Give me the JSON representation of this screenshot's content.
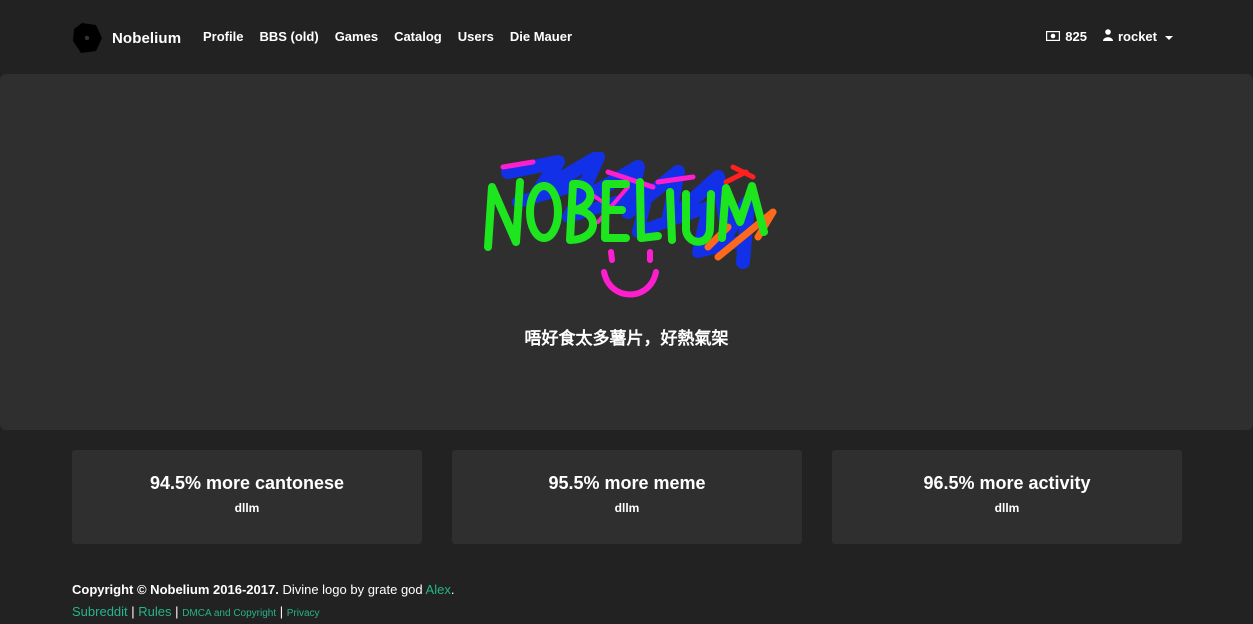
{
  "navbar": {
    "brand": "Nobelium",
    "links": [
      "Profile",
      "BBS (old)",
      "Games",
      "Catalog",
      "Users",
      "Die Mauer"
    ],
    "money": "825",
    "username": "rocket"
  },
  "hero": {
    "logo_text": "NOBELIUM",
    "tagline": "唔好食太多薯片，好熱氣架"
  },
  "features": [
    {
      "title": "94.5% more cantonese",
      "subtitle": "dllm"
    },
    {
      "title": "95.5% more meme",
      "subtitle": "dllm"
    },
    {
      "title": "96.5% more activity",
      "subtitle": "dllm"
    }
  ],
  "footer": {
    "copyright": "Copyright © Nobelium 2016-2017.",
    "logo_credit": "Divine logo by grate god",
    "credit_link": "Alex",
    "credit_period": ".",
    "links": [
      "Subreddit",
      "Rules",
      "DMCA and Copyright",
      "Privacy"
    ]
  },
  "colors": {
    "background": "#222222",
    "panel": "#2f2f2f",
    "link": "#24b58a",
    "logo_green": "#1ee61e",
    "logo_blue": "#1230e8",
    "logo_magenta": "#ff1ecf",
    "logo_orange": "#ff6a1a",
    "logo_red": "#ff2020"
  },
  "icons": {
    "brand": "hexagon-logo-icon",
    "money": "money-bill-icon",
    "user": "user-icon",
    "dropdown": "caret-down-icon"
  }
}
